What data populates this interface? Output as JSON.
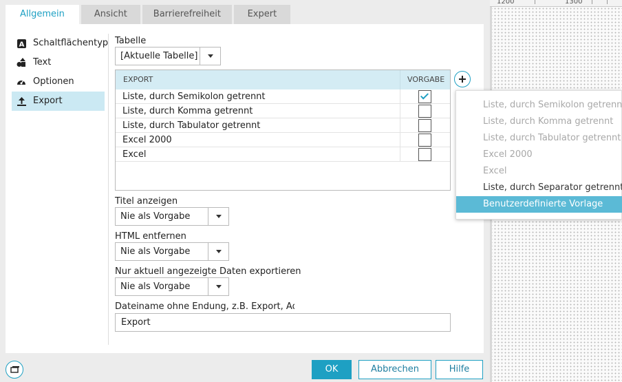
{
  "tabs": [
    {
      "label": "Allgemein",
      "active": true
    },
    {
      "label": "Ansicht",
      "active": false
    },
    {
      "label": "Barrierefreiheit",
      "active": false
    },
    {
      "label": "Expert",
      "active": false
    }
  ],
  "sidebar": {
    "items": [
      {
        "label": "Schaltflächentyp",
        "icon": "letter-a-icon"
      },
      {
        "label": "Text",
        "icon": "shapes-icon"
      },
      {
        "label": "Optionen",
        "icon": "gauge-icon"
      },
      {
        "label": "Export",
        "icon": "upload-icon",
        "active": true
      }
    ]
  },
  "form": {
    "tabelle_label": "Tabelle",
    "tabelle_value": "[Aktuelle Tabelle]",
    "grid": {
      "columns": [
        "EXPORT",
        "VORGABE"
      ],
      "rows": [
        {
          "label": "Liste, durch Semikolon getrennt",
          "checked": true
        },
        {
          "label": "Liste, durch Komma getrennt",
          "checked": false
        },
        {
          "label": "Liste, durch Tabulator getrennt",
          "checked": false
        },
        {
          "label": "Excel 2000",
          "checked": false
        },
        {
          "label": "Excel",
          "checked": false
        }
      ]
    },
    "titel_label": "Titel anzeigen",
    "titel_value": "Nie als Vorgabe",
    "html_label": "HTML entfernen",
    "html_value": "Nie als Vorgabe",
    "nur_label": "Nur aktuell angezeigte Daten exportieren",
    "nur_value": "Nie als Vorgabe",
    "dateiname_label": "Dateiname ohne Endung, z.B. Export, Adress",
    "dateiname_value": "Export"
  },
  "popup": {
    "items": [
      {
        "label": "Liste, durch Semikolon getrennt",
        "state": "disabled"
      },
      {
        "label": "Liste, durch Komma getrennt",
        "state": "disabled"
      },
      {
        "label": "Liste, durch Tabulator getrennt",
        "state": "disabled"
      },
      {
        "label": "Excel 2000",
        "state": "disabled"
      },
      {
        "label": "Excel",
        "state": "disabled"
      },
      {
        "label": "Liste, durch Separator getrennt",
        "state": "enabled"
      },
      {
        "label": "Benutzerdefinierte Vorlage",
        "state": "selected"
      }
    ]
  },
  "buttons": {
    "ok": "OK",
    "cancel": "Abbrechen",
    "help": "Hilfe"
  },
  "ruler": {
    "labels": [
      "1200",
      "1300"
    ]
  },
  "colors": {
    "accent": "#1ea0c3",
    "grid_header": "#d4ecf4",
    "selection": "#5bbad6",
    "sidebar_active": "#cbe9f3"
  }
}
